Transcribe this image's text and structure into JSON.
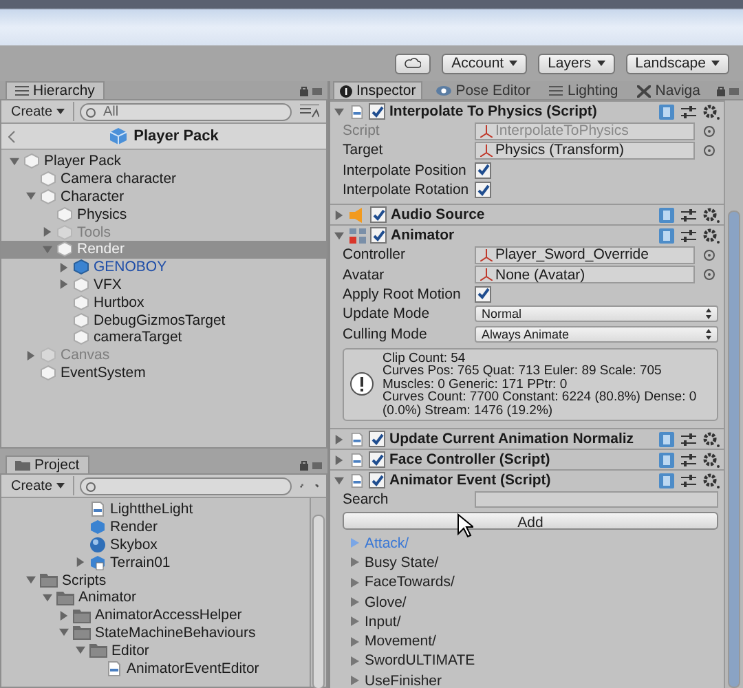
{
  "toolbar": {
    "buttons": [
      {
        "kind": "cloud"
      },
      {
        "kind": "dropdown",
        "label": "Account"
      },
      {
        "kind": "dropdown",
        "label": "Layers"
      },
      {
        "kind": "dropdown",
        "label": "Landscape"
      }
    ]
  },
  "hierarchy": {
    "tab": "Hierarchy",
    "create": "Create",
    "search_placeholder": "All",
    "header": "Player Pack",
    "tree": [
      {
        "label": "Player Pack",
        "kind": "object",
        "expanded": true,
        "selected": false,
        "active": true,
        "children": [
          {
            "label": "Camera character",
            "kind": "object",
            "selected": false,
            "active": true
          },
          {
            "label": "Character",
            "kind": "object",
            "expanded": true,
            "selected": false,
            "active": true,
            "children": [
              {
                "label": "Physics",
                "kind": "object",
                "selected": false,
                "active": true
              },
              {
                "label": "Tools",
                "kind": "object",
                "expanded": false,
                "selected": false,
                "active": false
              },
              {
                "label": "Render",
                "kind": "object",
                "expanded": true,
                "selected": true,
                "active": true,
                "children": [
                  {
                    "label": "GENOBOY",
                    "kind": "prefab",
                    "expanded": false,
                    "selected": false,
                    "active": true
                  },
                  {
                    "label": "VFX",
                    "kind": "object",
                    "expanded": false,
                    "selected": false,
                    "active": true
                  },
                  {
                    "label": "Hurtbox",
                    "kind": "object",
                    "selected": false,
                    "active": true
                  },
                  {
                    "label": "DebugGizmosTarget",
                    "kind": "object",
                    "selected": false,
                    "active": true
                  },
                  {
                    "label": "cameraTarget",
                    "kind": "object",
                    "selected": false,
                    "active": true
                  }
                ]
              }
            ]
          },
          {
            "label": "Canvas",
            "kind": "object",
            "expanded": false,
            "selected": false,
            "active": false
          },
          {
            "label": "EventSystem",
            "kind": "object",
            "selected": false,
            "active": true
          }
        ]
      }
    ]
  },
  "project": {
    "tab": "Project",
    "create": "Create",
    "scrolled_items": [
      {
        "label": "LighttheLight",
        "kind": "script"
      },
      {
        "label": "Render",
        "kind": "prefab"
      },
      {
        "label": "Skybox",
        "kind": "sphere"
      },
      {
        "label": "Terrain01",
        "kind": "terrain",
        "expanded": false
      }
    ],
    "tree": [
      {
        "label": "Scripts",
        "kind": "folder",
        "expanded": true,
        "children": [
          {
            "label": "Animator",
            "kind": "folder",
            "expanded": true,
            "children": [
              {
                "label": "AnimatorAccessHelper",
                "kind": "folder",
                "expanded": false
              },
              {
                "label": "StateMachineBehaviours",
                "kind": "folder",
                "expanded": true,
                "children": [
                  {
                    "label": "Editor",
                    "kind": "folder",
                    "expanded": true,
                    "children": [
                      {
                        "label": "AnimatorEventEditor",
                        "kind": "script"
                      }
                    ]
                  }
                ]
              }
            ]
          }
        ]
      }
    ]
  },
  "inspector": {
    "tabs": [
      {
        "label": "Inspector",
        "kind": "info",
        "selected": true
      },
      {
        "label": "Pose Editor",
        "kind": "eye",
        "selected": false
      },
      {
        "label": "Lighting",
        "kind": "lines",
        "selected": false
      },
      {
        "label": "Naviga",
        "kind": "nav",
        "selected": false
      }
    ],
    "components": [
      {
        "title": "Interpolate To Physics (Script)",
        "kind": "script",
        "expanded": true,
        "enabled": true,
        "fields": [
          {
            "kind": "object",
            "label": "Script",
            "value": "InterpolateToPhysics",
            "disabled": true
          },
          {
            "kind": "object",
            "label": "Target",
            "value": "Physics (Transform)",
            "disabled": false
          },
          {
            "kind": "checkbox",
            "label": "Interpolate Position",
            "checked": true
          },
          {
            "kind": "checkbox",
            "label": "Interpolate Rotation",
            "checked": true
          }
        ]
      },
      {
        "title": "Audio Source",
        "kind": "audio",
        "expanded": false,
        "enabled": true
      },
      {
        "title": "Animator",
        "kind": "animator",
        "expanded": true,
        "enabled": true,
        "fields": [
          {
            "kind": "object",
            "label": "Controller",
            "value": "Player_Sword_Override",
            "disabled": false
          },
          {
            "kind": "object",
            "label": "Avatar",
            "value": "None (Avatar)",
            "disabled": false
          },
          {
            "kind": "checkbox",
            "label": "Apply Root Motion",
            "checked": true
          },
          {
            "kind": "dropdown",
            "label": "Update Mode",
            "value": "Normal"
          },
          {
            "kind": "dropdown",
            "label": "Culling Mode",
            "value": "Always Animate"
          },
          {
            "kind": "info",
            "lines": [
              "Clip Count: 54",
              "Curves Pos: 765 Quat: 713 Euler: 89 Scale: 705",
              "Muscles: 0 Generic: 171 PPtr: 0",
              "Curves Count: 7700 Constant: 6224 (80.8%) Dense: 0",
              "(0.0%) Stream: 1476 (19.2%)"
            ]
          }
        ]
      },
      {
        "title": "Update Current Animation Normaliz",
        "kind": "script",
        "expanded": false,
        "enabled": true
      },
      {
        "title": "Face Controller (Script)",
        "kind": "script",
        "expanded": false,
        "enabled": true
      },
      {
        "title": "Animator Event (Script)",
        "kind": "script",
        "expanded": true,
        "enabled": true,
        "fields": [
          {
            "kind": "search",
            "label": "Search"
          },
          {
            "kind": "button",
            "label": "Add"
          },
          {
            "kind": "list",
            "items": [
              {
                "label": "Attack/",
                "selected": true
              },
              {
                "label": "Busy State/",
                "selected": false
              },
              {
                "label": "FaceTowards/",
                "selected": false
              },
              {
                "label": "Glove/",
                "selected": false
              },
              {
                "label": "Input/",
                "selected": false
              },
              {
                "label": "Movement/",
                "selected": false
              },
              {
                "label": "SwordULTIMATE",
                "selected": false
              },
              {
                "label": "UseFinisher",
                "selected": false
              }
            ]
          }
        ]
      }
    ]
  }
}
